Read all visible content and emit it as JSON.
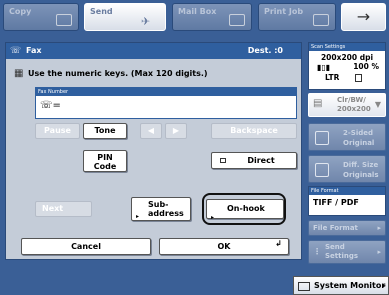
{
  "tabs": [
    {
      "label": "Copy",
      "state": "inactive"
    },
    {
      "label": "Send",
      "state": "active"
    },
    {
      "label": "Mail Box",
      "state": "inactive"
    },
    {
      "label": "Print Job",
      "state": "inactive"
    }
  ],
  "fax": {
    "title": "Fax",
    "dest": "Dest. :0",
    "instruction": "Use the numeric keys. (Max 120 digits.)",
    "number_label": "Fax Number",
    "number_value": "☏="
  },
  "buttons": {
    "pause": "Pause",
    "tone": "Tone",
    "backspace": "Backspace",
    "pin_code_1": "PIN",
    "pin_code_2": "Code",
    "direct": "Direct",
    "next": "Next",
    "subaddress_1": "Sub-",
    "subaddress_2": "address",
    "on_hook": "On-hook",
    "cancel": "Cancel",
    "ok": "OK"
  },
  "right_panel": {
    "scan_settings_label": "Scan Settings",
    "resolution": "200x200 dpi",
    "zoom": "100 %",
    "paper": "LTR",
    "color_mode_1": "Clr/BW/",
    "color_mode_2": "200x200",
    "two_sided_1": "2-Sided",
    "two_sided_2": "Original",
    "diff_size_1": "Diff. Size",
    "diff_size_2": "Originals",
    "file_format_label": "File Format",
    "file_format_value": "TIFF / PDF",
    "file_format_btn": "File Format",
    "send_settings_1": "Send",
    "send_settings_2": "Settings"
  },
  "status": {
    "system_monitor": "System Monitor"
  },
  "colors": {
    "background": "#3a5f96",
    "panel": "#c4ccd8",
    "header": "#2f5f9f"
  }
}
